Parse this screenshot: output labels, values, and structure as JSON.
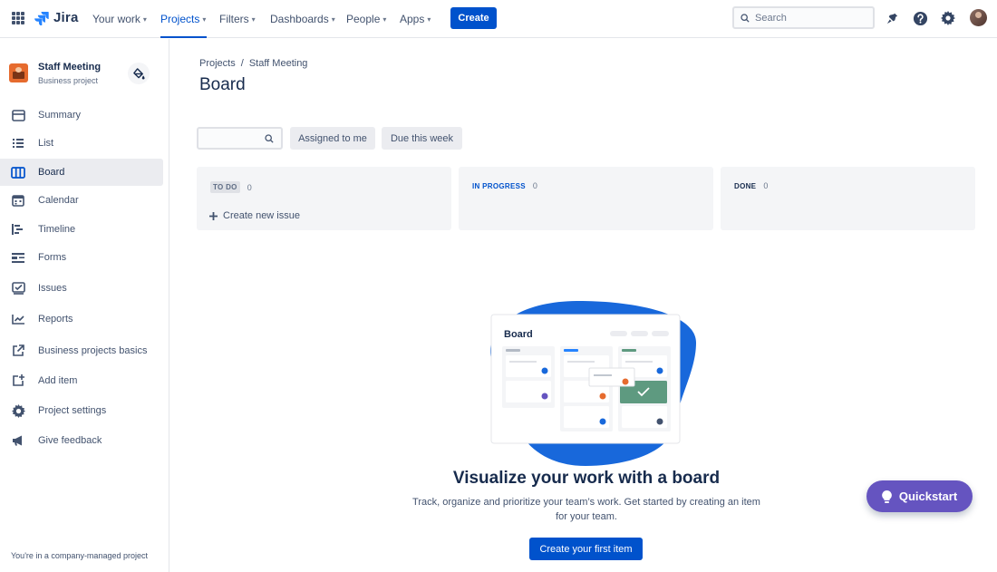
{
  "topnav": {
    "logo_text": "Jira",
    "items": [
      {
        "label": "Your work"
      },
      {
        "label": "Projects"
      },
      {
        "label": "Filters"
      },
      {
        "label": "Dashboards"
      },
      {
        "label": "People"
      },
      {
        "label": "Apps"
      }
    ],
    "active_item": "Projects",
    "create_label": "Create",
    "search_placeholder": "Search",
    "icons": [
      "apps-grid-icon",
      "notifications-icon",
      "help-icon",
      "settings-icon",
      "profile-avatar"
    ]
  },
  "sidebar": {
    "project_name": "Staff Meeting",
    "project_type": "Business project",
    "items": [
      {
        "label": "Summary",
        "icon": "summary-icon"
      },
      {
        "label": "List",
        "icon": "list-icon"
      },
      {
        "label": "Board",
        "icon": "board-icon"
      },
      {
        "label": "Calendar",
        "icon": "calendar-icon"
      },
      {
        "label": "Timeline",
        "icon": "timeline-icon"
      },
      {
        "label": "Forms",
        "icon": "forms-icon"
      },
      {
        "label": "Issues",
        "icon": "issues-icon"
      },
      {
        "label": "Reports",
        "icon": "reports-icon"
      },
      {
        "label": "Business projects basics",
        "icon": "external-link-icon"
      },
      {
        "label": "Add item",
        "icon": "add-item-icon"
      },
      {
        "label": "Project settings",
        "icon": "gear-icon"
      },
      {
        "label": "Give feedback",
        "icon": "megaphone-icon"
      }
    ],
    "active_item": "Board",
    "footer": "You're in a company-managed project"
  },
  "main": {
    "breadcrumb": [
      "Projects",
      "Staff Meeting"
    ],
    "breadcrumb_separator": "/",
    "title": "Board",
    "filters": [
      "Assigned to me",
      "Due this week"
    ],
    "columns": [
      {
        "name": "TO DO",
        "count": "0"
      },
      {
        "name": "IN PROGRESS",
        "count": "0"
      },
      {
        "name": "DONE",
        "count": "0"
      }
    ],
    "create_issue_label": "Create new issue",
    "empty_state": {
      "illustration_title": "Board",
      "title": "Visualize your work with a board",
      "description": "Track, organize and prioritize your team’s work. Get started by creating an item for your team.",
      "button": "Create your first item"
    }
  },
  "quickstart": {
    "label": "Quickstart"
  },
  "colors": {
    "brand_blue": "#0052cc",
    "quickstart_purple": "#6554c0",
    "illustration_blob": "#1868db",
    "done_green": "#5e9a80"
  }
}
